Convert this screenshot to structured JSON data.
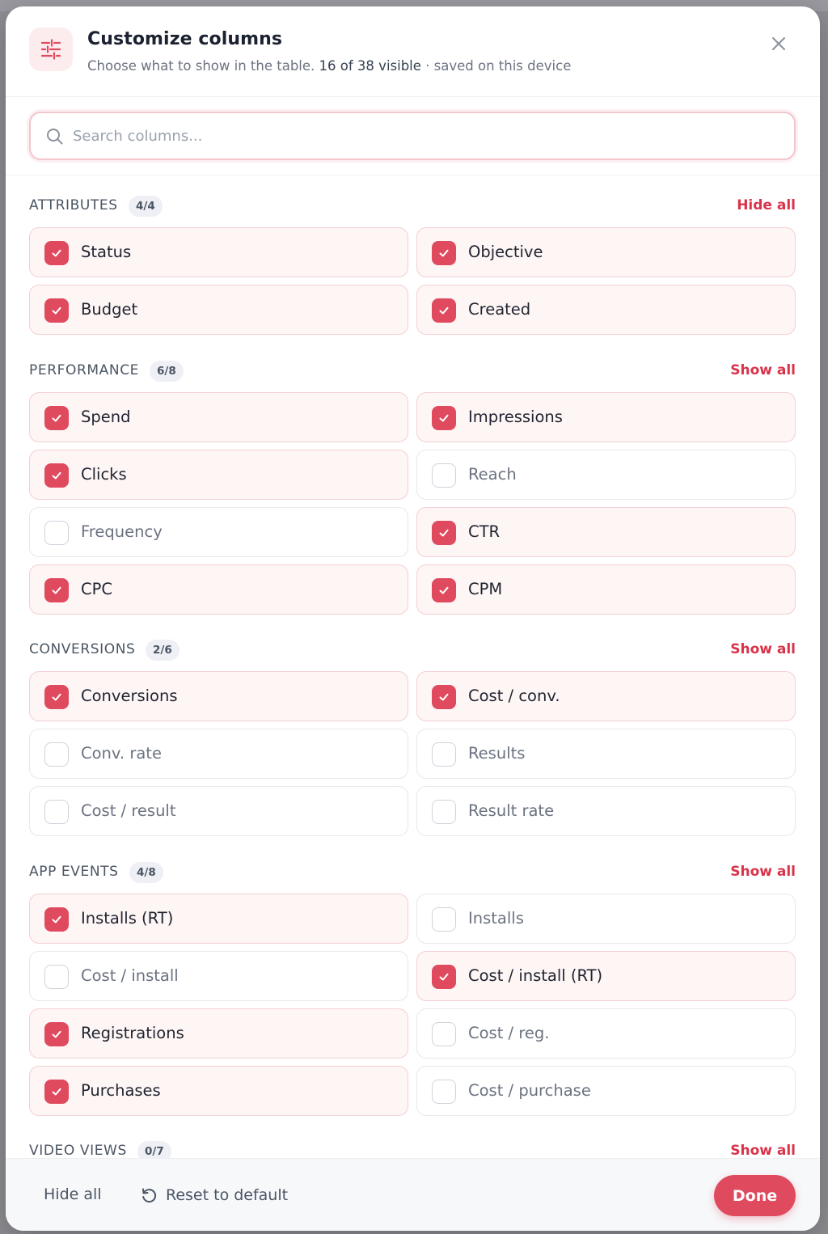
{
  "header": {
    "title": "Customize columns",
    "subtitle_prefix": "Choose what to show in the table.",
    "visible_count": "16 of 38 visible",
    "subtitle_suffix": "· saved on this device",
    "icon": "sliders-icon",
    "close_icon": "close-icon"
  },
  "search": {
    "placeholder": "Search columns...",
    "value": ""
  },
  "colors": {
    "accent": "#e04a5f",
    "action_text": "#d9334a",
    "selected_tile_bg": "#fef5f5"
  },
  "sections": [
    {
      "title": "ATTRIBUTES",
      "badge": "4/4",
      "action": "Hide all",
      "items": [
        {
          "label": "Status",
          "checked": true
        },
        {
          "label": "Objective",
          "checked": true
        },
        {
          "label": "Budget",
          "checked": true
        },
        {
          "label": "Created",
          "checked": true
        }
      ]
    },
    {
      "title": "PERFORMANCE",
      "badge": "6/8",
      "action": "Show all",
      "items": [
        {
          "label": "Spend",
          "checked": true
        },
        {
          "label": "Impressions",
          "checked": true
        },
        {
          "label": "Clicks",
          "checked": true
        },
        {
          "label": "Reach",
          "checked": false
        },
        {
          "label": "Frequency",
          "checked": false
        },
        {
          "label": "CTR",
          "checked": true
        },
        {
          "label": "CPC",
          "checked": true
        },
        {
          "label": "CPM",
          "checked": true
        }
      ]
    },
    {
      "title": "CONVERSIONS",
      "badge": "2/6",
      "action": "Show all",
      "items": [
        {
          "label": "Conversions",
          "checked": true
        },
        {
          "label": "Cost / conv.",
          "checked": true
        },
        {
          "label": "Conv. rate",
          "checked": false
        },
        {
          "label": "Results",
          "checked": false
        },
        {
          "label": "Cost / result",
          "checked": false
        },
        {
          "label": "Result rate",
          "checked": false
        }
      ]
    },
    {
      "title": "APP EVENTS",
      "badge": "4/8",
      "action": "Show all",
      "items": [
        {
          "label": "Installs (RT)",
          "checked": true
        },
        {
          "label": "Installs",
          "checked": false
        },
        {
          "label": "Cost / install",
          "checked": false
        },
        {
          "label": "Cost / install (RT)",
          "checked": true
        },
        {
          "label": "Registrations",
          "checked": true
        },
        {
          "label": "Cost / reg.",
          "checked": false
        },
        {
          "label": "Purchases",
          "checked": true
        },
        {
          "label": "Cost / purchase",
          "checked": false
        }
      ]
    },
    {
      "title": "VIDEO VIEWS",
      "badge": "0/7",
      "action": "Show all",
      "items": []
    }
  ],
  "footer": {
    "hide_all": "Hide all",
    "reset": "Reset to default",
    "reset_icon": "undo-icon",
    "done": "Done"
  }
}
